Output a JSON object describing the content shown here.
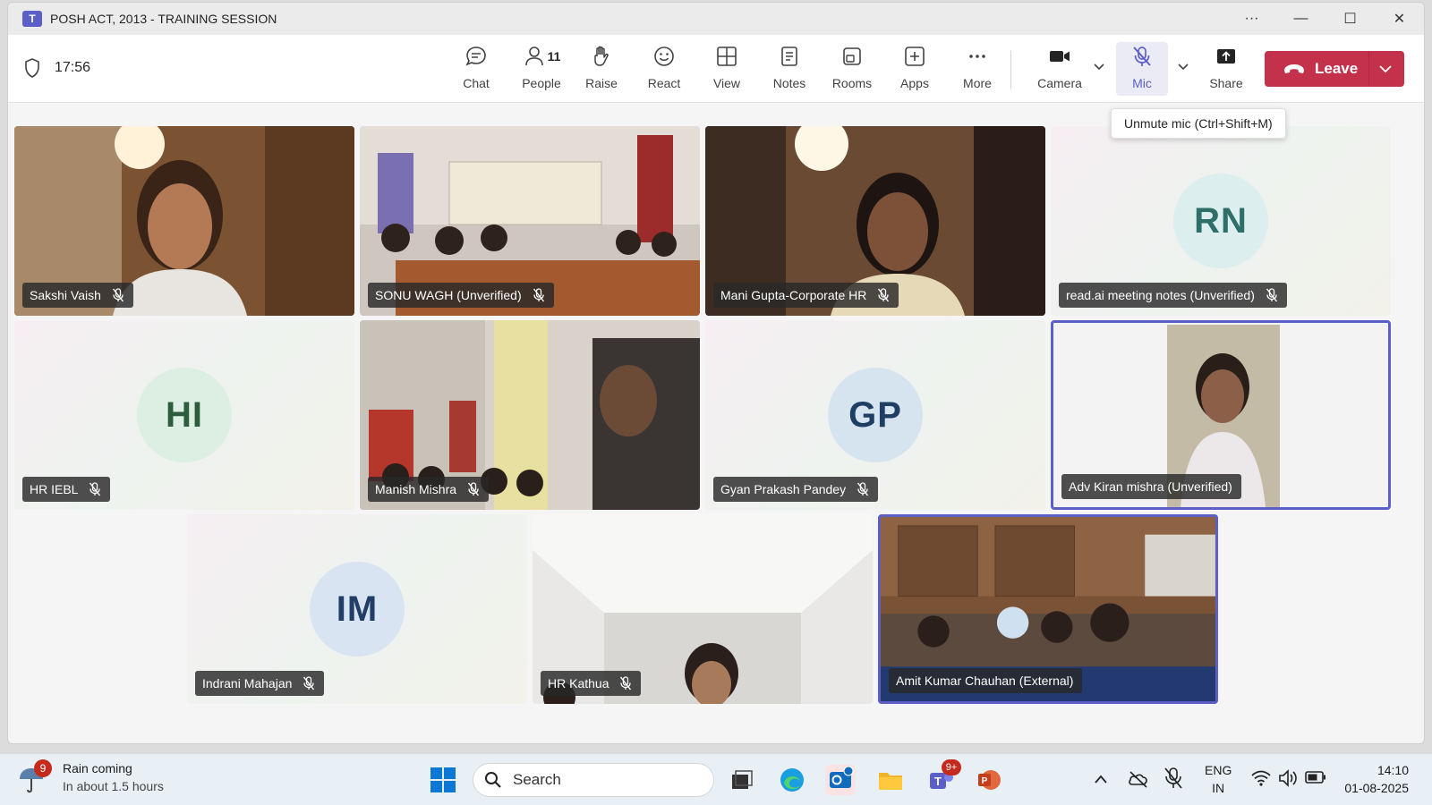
{
  "window": {
    "title": "POSH ACT, 2013 - TRAINING SESSION",
    "controls": {
      "more": "···",
      "minimize": "—",
      "maximize": "☐",
      "close": "✕"
    }
  },
  "toolbar": {
    "timer": "17:56",
    "chat": "Chat",
    "people": "People",
    "people_count": "11",
    "raise": "Raise",
    "react": "React",
    "view": "View",
    "notes": "Notes",
    "rooms": "Rooms",
    "apps": "Apps",
    "more": "More",
    "camera": "Camera",
    "mic": "Mic",
    "share": "Share",
    "leave": "Leave",
    "mic_tooltip": "Unmute mic (Ctrl+Shift+M)"
  },
  "participants": [
    {
      "name": "Sakshi Vaish",
      "video": true,
      "muted": true
    },
    {
      "name": "SONU WAGH (Unverified)",
      "video": true,
      "muted": true
    },
    {
      "name": "Mani Gupta-Corporate HR",
      "video": true,
      "muted": true
    },
    {
      "name": "read.ai meeting notes (Unverified)",
      "initials": "RN",
      "video": false,
      "muted": true,
      "avatar_bg": "#dcefee",
      "avatar_fg": "#2f6f6a"
    },
    {
      "name": "HR IEBL",
      "initials": "HI",
      "video": false,
      "muted": true,
      "avatar_bg": "#dcefe2",
      "avatar_fg": "#2e5d3e"
    },
    {
      "name": "Manish Mishra",
      "video": true,
      "muted": true
    },
    {
      "name": "Gyan Prakash Pandey",
      "initials": "GP",
      "video": false,
      "muted": true,
      "avatar_bg": "#d6e4f0",
      "avatar_fg": "#1f3e63"
    },
    {
      "name": "Adv Kiran mishra (Unverified)",
      "video": true,
      "muted": false,
      "speaking": true
    },
    {
      "name": "Indrani Mahajan",
      "initials": "IM",
      "video": false,
      "muted": true,
      "avatar_bg": "#d8e4f2",
      "avatar_fg": "#213f66"
    },
    {
      "name": "HR Kathua",
      "video": true,
      "muted": true
    },
    {
      "name": "Amit Kumar Chauhan (External)",
      "video": true,
      "muted": false,
      "speaking": true
    }
  ],
  "taskbar": {
    "weather_badge": "9",
    "weather_title": "Rain coming",
    "weather_sub": "In about 1.5 hours",
    "search": "Search",
    "teams_badge": "9+",
    "lang_1": "ENG",
    "lang_2": "IN",
    "time": "14:10",
    "date": "01-08-2025"
  }
}
